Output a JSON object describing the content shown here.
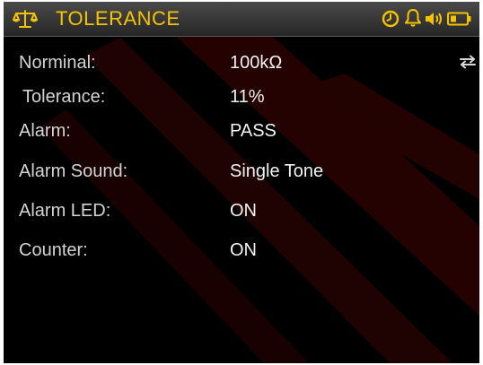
{
  "header": {
    "title": "TOLERANCE",
    "accent_color": "#f5c400",
    "icons": [
      "scale-icon",
      "clock-icon",
      "bell-icon",
      "speaker-icon",
      "battery-icon"
    ]
  },
  "settings": [
    {
      "label": "Norminal",
      "separator": ":",
      "value": "100kΩ"
    },
    {
      "label": "Tolerance",
      "separator": ":",
      "value": "11%"
    },
    {
      "label": "Alarm",
      "separator": ":",
      "value": "PASS"
    },
    {
      "label": "Alarm Sound",
      "separator": ":",
      "value": "Single Tone"
    },
    {
      "label": "Alarm LED",
      "separator": ":",
      "value": "ON"
    },
    {
      "label": "Counter",
      "separator": ":",
      "value": "ON"
    }
  ],
  "side_icon": "swap-arrows-icon"
}
